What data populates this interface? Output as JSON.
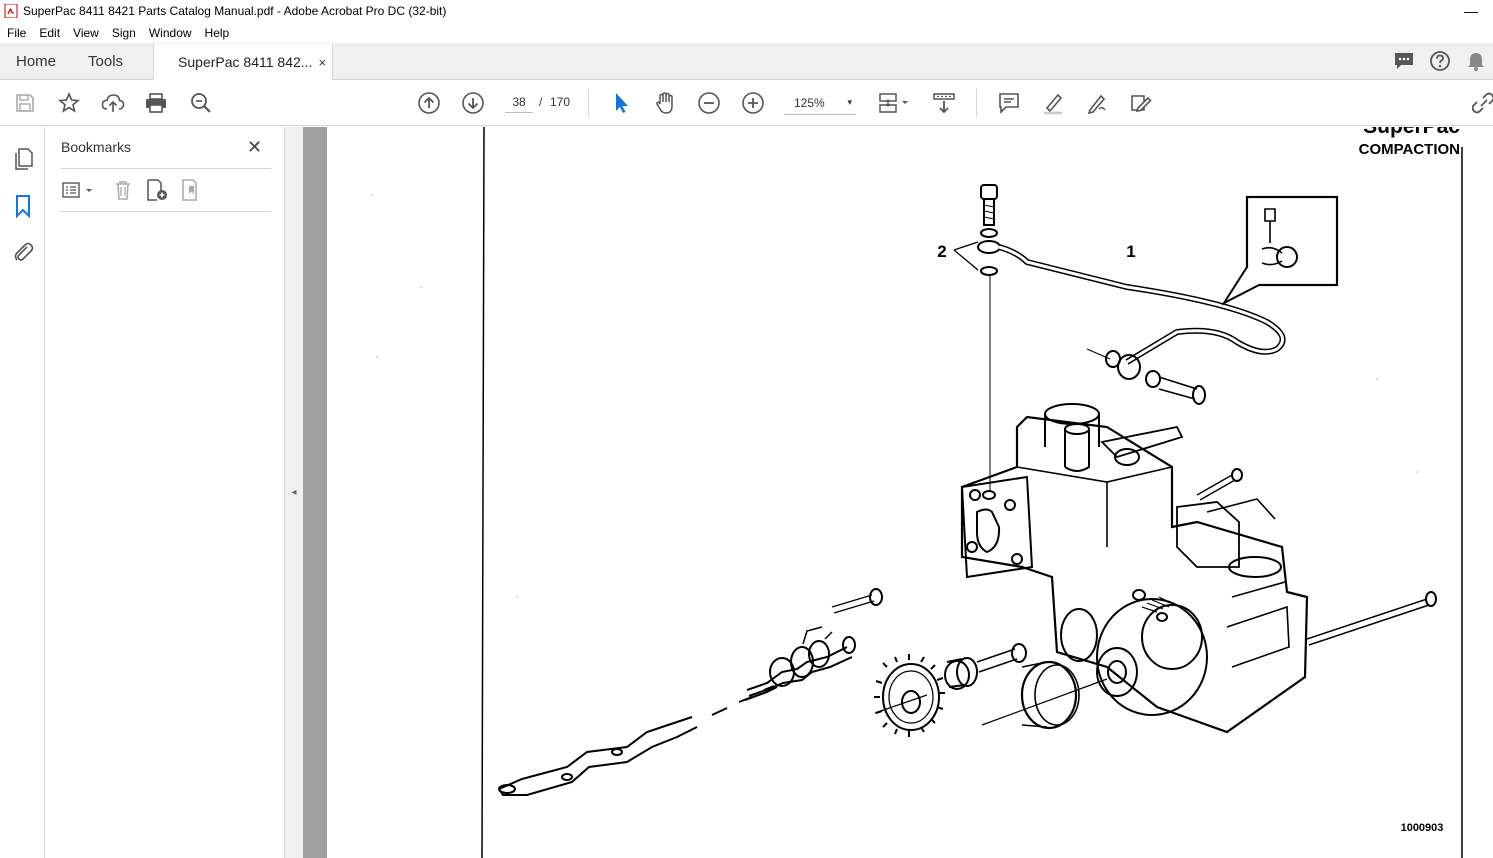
{
  "window": {
    "title": "SuperPac 8411 8421 Parts Catalog Manual.pdf - Adobe Acrobat Pro DC (32-bit)",
    "minimize_glyph": "—"
  },
  "menu": [
    "File",
    "Edit",
    "View",
    "Sign",
    "Window",
    "Help"
  ],
  "tabs": {
    "home": "Home",
    "tools": "Tools",
    "document": "SuperPac 8411 842...",
    "close_glyph": "×"
  },
  "toolbar": {
    "current_page": "38",
    "page_separator": "/",
    "total_pages": "170",
    "zoom": "125%",
    "zoom_caret": "▾",
    "icons": [
      "save-icon",
      "bookmark-star-icon",
      "upload-icon",
      "print-icon",
      "find-zoom-icon",
      "page-up-icon",
      "page-down-icon",
      "select-cursor-icon",
      "hand-icon",
      "zoom-out-icon",
      "zoom-in-icon",
      "page-layout-icon",
      "scroll-mode-icon",
      "comment-icon",
      "highlight-icon",
      "draw-icon",
      "fill-sign-icon",
      "link-icon"
    ],
    "accent_color": "#1473e6"
  },
  "tab_right_icons": [
    "chat-icon",
    "help-icon",
    "bell-icon"
  ],
  "left_rail": [
    "pages-icon",
    "bookmarks-icon",
    "attachments-icon"
  ],
  "bookmarks_panel": {
    "title": "Bookmarks",
    "close_glyph": "✕",
    "tools": [
      "options-menu-icon",
      "delete-bookmark-icon",
      "new-bookmark-icon",
      "bookmark-properties-icon"
    ]
  },
  "collapse_glyph": "◂",
  "document": {
    "brand_line1": "SuperPac",
    "brand_line2": "COMPACTION",
    "callout_1": "1",
    "callout_2": "2",
    "figure_id": "1000903"
  }
}
